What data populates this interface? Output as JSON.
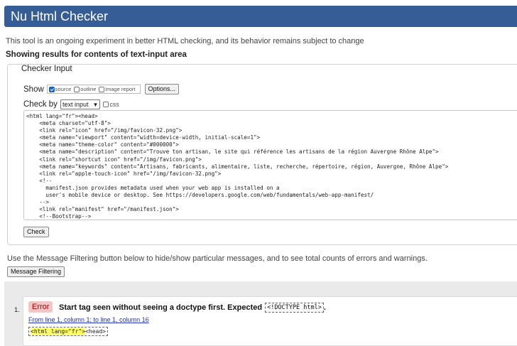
{
  "header": {
    "title": "Nu Html Checker"
  },
  "intro": "This tool is an ongoing experiment in better HTML checking, and its behavior remains subject to change",
  "showing": "Showing results for contents of text-input area",
  "checker": {
    "legend": "Checker Input",
    "show_label": "Show",
    "options": [
      {
        "label": "source",
        "checked": true
      },
      {
        "label": "outline",
        "checked": false
      },
      {
        "label": "image report",
        "checked": false
      }
    ],
    "options_button": "Options...",
    "check_by_label": "Check by",
    "check_by_value": "text input",
    "css_label": "css",
    "source_lines": [
      "<html lang=\"fr\"><head>",
      "    <meta charset=\"utf-8\">",
      "    <link rel=\"icon\" href=\"/img/favicon-32.png\">",
      "    <meta name=\"viewport\" content=\"width=device-width, initial-scale=1\">",
      "    <meta name=\"theme-color\" content=\"#000000\">",
      "    <meta name=\"description\" content=\"Trouve ton artisan, le site qui référence les artisans de la région Auvergne Rhône Alpe\">",
      "    <link rel=\"shortcut icon\" href=\"/img/favicon.png\">",
      "    <meta name=\"keywords\" content=\"Artisans, fabricants, alimentaire, liste, recherche, répertoire, région, Auvergne, Rhône Alpe\">",
      "    <link rel=\"apple-touch-icon\" href=\"/img/favicon-32.png\">",
      "    <!--",
      "      manifest.json provides metadata used when your web app is installed on a",
      "      user's mobile device or desktop. See https://developers.google.com/web/fundamentals/web-app-manifest/",
      "    -->",
      "    <link rel=\"manifest\" href=\"/manifest.json\">",
      "    <!--Bootstrap-->"
    ],
    "check_button": "Check"
  },
  "filter": {
    "text": "Use the Message Filtering button below to hide/show particular messages, and to see total counts of errors and warnings.",
    "button": "Message Filtering"
  },
  "results": {
    "number": "1.",
    "type": "Error",
    "message": "Start tag seen without seeing a doctype first. Expected",
    "code": "<!DOCTYPE html>",
    "period": ".",
    "location": "From line 1, column 1; to line 1, column 16",
    "extract_highlight": "<html lang=\"fr\">",
    "extract_rest": "<head>"
  }
}
